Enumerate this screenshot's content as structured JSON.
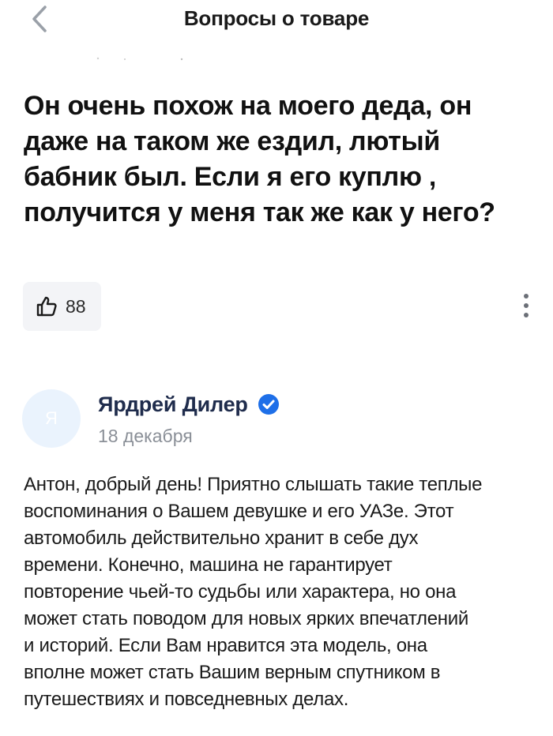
{
  "header": {
    "title": "Вопросы о товаре",
    "back_icon": "chevron-left-icon"
  },
  "question": {
    "text": "Он очень похож на моего деда, он даже на таком же ездил, лютый бабник был. Если я его куплю , получится у меня так же как у него?",
    "likes": "88",
    "like_icon": "thumbs-up-icon",
    "more_icon": "more-vertical-icon"
  },
  "answer": {
    "avatar_letter": "Я",
    "author": "Ярдрей Дилер",
    "verified_icon": "verified-check-icon",
    "date": "18 декабря",
    "text": "Антон, добрый день! Приятно слышать такие теплые\nвоспоминания о Вашем девушке и его УАЗе. Этот\nавтомобиль действительно хранит в себе дух\nвремени. Конечно, машина не гарантирует\nповторение чьей-то судьбы или характера, но она\nможет стать поводом для новых ярких впечатлений\nи историй. Если Вам нравится эта модель, она\nвполне может стать Вашим верным спутником в\nпутешествиях и повседневных делах."
  },
  "colors": {
    "accent_blue": "#1e6fe8",
    "author_navy": "#1f2c4c",
    "muted_gray": "#8a8f97",
    "like_bg": "#f3f4f7",
    "avatar_bg": "#eaf3fd"
  }
}
